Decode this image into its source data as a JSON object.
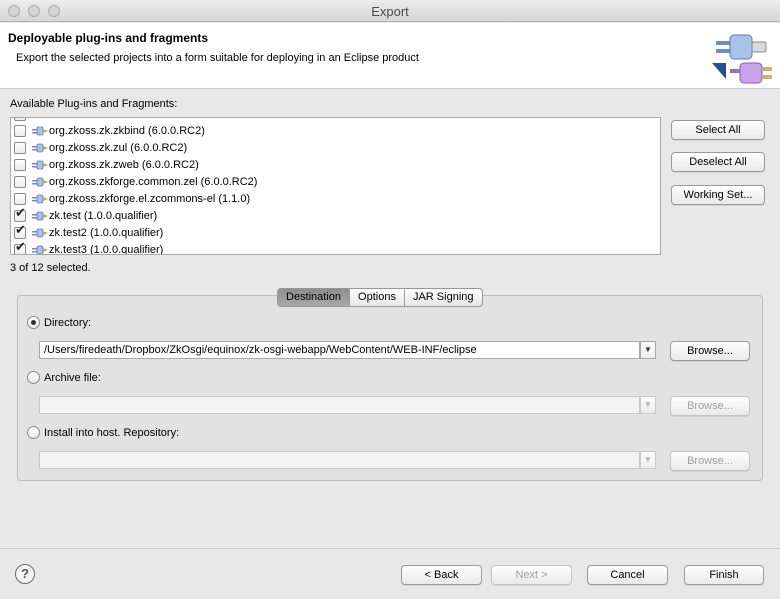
{
  "window": {
    "title": "Export"
  },
  "header": {
    "title": "Deployable plug-ins and fragments",
    "description": "Export the selected projects into a form suitable for deploying in an Eclipse product"
  },
  "available": {
    "label": "Available Plug-ins and Fragments:",
    "items": [
      {
        "label": "org.zkoss.zk.zkbind (6.0.0.RC2)",
        "checked": false
      },
      {
        "label": "org.zkoss.zk.zul (6.0.0.RC2)",
        "checked": false
      },
      {
        "label": "org.zkoss.zk.zweb (6.0.0.RC2)",
        "checked": false
      },
      {
        "label": "org.zkoss.zkforge.common.zel (6.0.0.RC2)",
        "checked": false
      },
      {
        "label": "org.zkoss.zkforge.el.zcommons-el (1.1.0)",
        "checked": false
      },
      {
        "label": "zk.test (1.0.0.qualifier)",
        "checked": true
      },
      {
        "label": "zk.test2 (1.0.0.qualifier)",
        "checked": true
      },
      {
        "label": "zk.test3 (1.0.0.qualifier)",
        "checked": true
      }
    ],
    "check_mark": "✔",
    "status": "3 of 12 selected."
  },
  "side_buttons": {
    "select_all": "Select All",
    "deselect_all": "Deselect All",
    "working_set": "Working Set..."
  },
  "tabs": [
    {
      "label": "Destination",
      "active": true
    },
    {
      "label": "Options",
      "active": false
    },
    {
      "label": "JAR Signing",
      "active": false
    }
  ],
  "destination": {
    "directory_label": "Directory:",
    "directory_value": "/Users/firedeath/Dropbox/ZkOsgi/equinox/zk-osgi-webapp/WebContent/WEB-INF/eclipse",
    "archive_label": "Archive file:",
    "archive_value": "",
    "repo_label": "Install into host. Repository:",
    "repo_value": "",
    "browse_label": "Browse...",
    "selected": "directory",
    "dropdown_arrow": "▼"
  },
  "footer": {
    "help": "?",
    "back": "< Back",
    "next": "Next >",
    "cancel": "Cancel",
    "finish": "Finish"
  }
}
